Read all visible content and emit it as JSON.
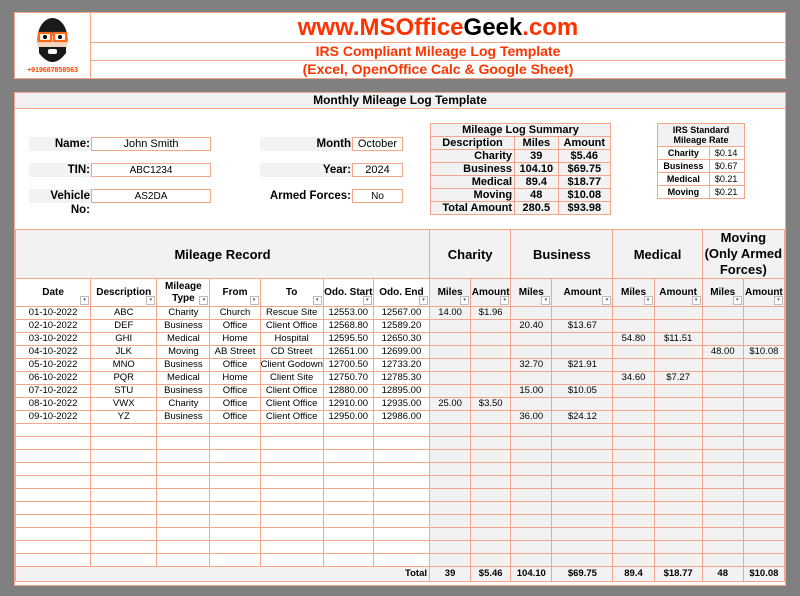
{
  "header": {
    "site_prefix": "www.MSOffice",
    "site_geek": "Geek",
    "site_suffix": ".com",
    "subtitle1": "IRS Compliant Mileage Log Template",
    "subtitle2": "(Excel, OpenOffice Calc & Google Sheet)",
    "phone": "+919687858563",
    "logo_icon": "geek-avatar-icon"
  },
  "colors": {
    "accent": "#ff3300",
    "border": "#f4a58a",
    "header_fill": "#f2f2f2",
    "background": "#808080"
  },
  "main": {
    "title": "Monthly Mileage Log Template"
  },
  "fields": {
    "name_label": "Name:",
    "name": "John Smith",
    "tin_label": "TIN:",
    "tin": "ABC1234",
    "vehicle_label": "Vehicle No:",
    "vehicle": "AS2DA",
    "month_label": "Month",
    "month": "October",
    "year_label": "Year:",
    "year": "2024",
    "armed_label": "Armed Forces:",
    "armed": "No"
  },
  "summary": {
    "title": "Mileage Log Summary",
    "headers": [
      "Description",
      "Miles",
      "Amount"
    ],
    "rows": [
      {
        "desc": "Charity",
        "miles": "39",
        "amount": "$5.46"
      },
      {
        "desc": "Business",
        "miles": "104.10",
        "amount": "$69.75"
      },
      {
        "desc": "Medical",
        "miles": "89.4",
        "amount": "$18.77"
      },
      {
        "desc": "Moving",
        "miles": "48",
        "amount": "$10.08"
      },
      {
        "desc": "Total Amount",
        "miles": "280.5",
        "amount": "$93.98"
      }
    ]
  },
  "irs": {
    "title": "IRS Standard Mileage Rate",
    "rows": [
      {
        "type": "Charity",
        "rate": "$0.14"
      },
      {
        "type": "Business",
        "rate": "$0.67"
      },
      {
        "type": "Medical",
        "rate": "$0.21"
      },
      {
        "type": "Moving",
        "rate": "$0.21"
      }
    ]
  },
  "log": {
    "groups": [
      "Mileage Record",
      "Charity",
      "Business",
      "Medical",
      "Moving (Only Armed Forces)"
    ],
    "columns": [
      "Date",
      "Description",
      "Mileage Type",
      "From",
      "To",
      "Odo. Start",
      "Odo. End",
      "Miles",
      "Amount",
      "Miles",
      "Amount",
      "Miles",
      "Amount",
      "Miles",
      "Amount"
    ],
    "rows": [
      [
        "01-10-2022",
        "ABC",
        "Charity",
        "Church",
        "Rescue Site",
        "12553.00",
        "12567.00",
        "14.00",
        "$1.96",
        "",
        "",
        "",
        "",
        "",
        ""
      ],
      [
        "02-10-2022",
        "DEF",
        "Business",
        "Office",
        "Client Office",
        "12568.80",
        "12589.20",
        "",
        "",
        "20.40",
        "$13.67",
        "",
        "",
        "",
        ""
      ],
      [
        "03-10-2022",
        "GHI",
        "Medical",
        "Home",
        "Hospital",
        "12595.50",
        "12650.30",
        "",
        "",
        "",
        "",
        "54.80",
        "$11.51",
        "",
        ""
      ],
      [
        "04-10-2022",
        "JLK",
        "Moving",
        "AB Street",
        "CD Street",
        "12651.00",
        "12699.00",
        "",
        "",
        "",
        "",
        "",
        "",
        "48.00",
        "$10.08"
      ],
      [
        "05-10-2022",
        "MNO",
        "Business",
        "Office",
        "Client Godown",
        "12700.50",
        "12733.20",
        "",
        "",
        "32.70",
        "$21.91",
        "",
        "",
        "",
        ""
      ],
      [
        "06-10-2022",
        "PQR",
        "Medical",
        "Home",
        "Client Site",
        "12750.70",
        "12785.30",
        "",
        "",
        "",
        "",
        "34.60",
        "$7.27",
        "",
        ""
      ],
      [
        "07-10-2022",
        "STU",
        "Business",
        "Office",
        "Client Office",
        "12880.00",
        "12895.00",
        "",
        "",
        "15.00",
        "$10.05",
        "",
        "",
        "",
        ""
      ],
      [
        "08-10-2022",
        "VWX",
        "Charity",
        "Office",
        "Client Office",
        "12910.00",
        "12935.00",
        "25.00",
        "$3.50",
        "",
        "",
        "",
        "",
        "",
        ""
      ],
      [
        "09-10-2022",
        "YZ",
        "Business",
        "Office",
        "Client Office",
        "12950.00",
        "12986.00",
        "",
        "",
        "36.00",
        "$24.12",
        "",
        "",
        "",
        ""
      ],
      [
        "",
        "",
        "",
        "",
        "",
        "",
        "",
        "",
        "",
        "",
        "",
        "",
        "",
        "",
        ""
      ],
      [
        "",
        "",
        "",
        "",
        "",
        "",
        "",
        "",
        "",
        "",
        "",
        "",
        "",
        "",
        ""
      ],
      [
        "",
        "",
        "",
        "",
        "",
        "",
        "",
        "",
        "",
        "",
        "",
        "",
        "",
        "",
        ""
      ],
      [
        "",
        "",
        "",
        "",
        "",
        "",
        "",
        "",
        "",
        "",
        "",
        "",
        "",
        "",
        ""
      ],
      [
        "",
        "",
        "",
        "",
        "",
        "",
        "",
        "",
        "",
        "",
        "",
        "",
        "",
        "",
        ""
      ],
      [
        "",
        "",
        "",
        "",
        "",
        "",
        "",
        "",
        "",
        "",
        "",
        "",
        "",
        "",
        ""
      ],
      [
        "",
        "",
        "",
        "",
        "",
        "",
        "",
        "",
        "",
        "",
        "",
        "",
        "",
        "",
        ""
      ],
      [
        "",
        "",
        "",
        "",
        "",
        "",
        "",
        "",
        "",
        "",
        "",
        "",
        "",
        "",
        ""
      ],
      [
        "",
        "",
        "",
        "",
        "",
        "",
        "",
        "",
        "",
        "",
        "",
        "",
        "",
        "",
        ""
      ],
      [
        "",
        "",
        "",
        "",
        "",
        "",
        "",
        "",
        "",
        "",
        "",
        "",
        "",
        "",
        ""
      ],
      [
        "",
        "",
        "",
        "",
        "",
        "",
        "",
        "",
        "",
        "",
        "",
        "",
        "",
        "",
        ""
      ]
    ],
    "total_label": "Total",
    "totals": [
      "39",
      "$5.46",
      "104.10",
      "$69.75",
      "89.4",
      "$18.77",
      "48",
      "$10.08"
    ]
  }
}
